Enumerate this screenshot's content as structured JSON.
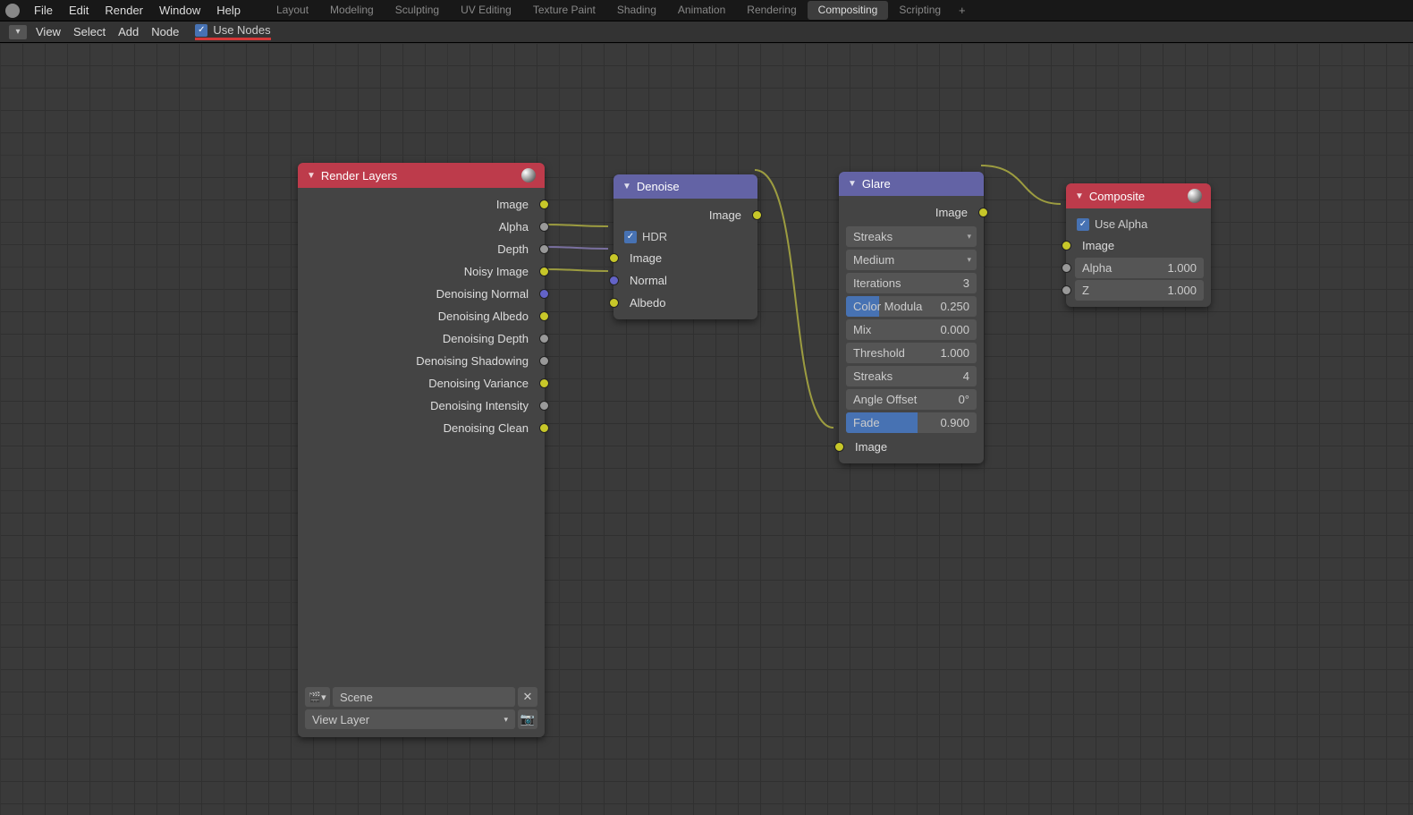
{
  "menu": {
    "file": "File",
    "edit": "Edit",
    "render": "Render",
    "window": "Window",
    "help": "Help"
  },
  "tabs": [
    "Layout",
    "Modeling",
    "Sculpting",
    "UV Editing",
    "Texture Paint",
    "Shading",
    "Animation",
    "Rendering",
    "Compositing",
    "Scripting"
  ],
  "active_tab": "Compositing",
  "submenu": {
    "view": "View",
    "select": "Select",
    "add": "Add",
    "node": "Node"
  },
  "use_nodes": "Use Nodes",
  "nodes": {
    "render": {
      "title": "Render Layers",
      "outputs": [
        "Image",
        "Alpha",
        "Depth",
        "Noisy Image",
        "Denoising Normal",
        "Denoising Albedo",
        "Denoising Depth",
        "Denoising Shadowing",
        "Denoising Variance",
        "Denoising Intensity",
        "Denoising Clean"
      ],
      "scene": "Scene",
      "view_layer": "View Layer"
    },
    "denoise": {
      "title": "Denoise",
      "out": "Image",
      "hdr": "HDR",
      "inputs": [
        "Image",
        "Normal",
        "Albedo"
      ]
    },
    "glare": {
      "title": "Glare",
      "out": "Image",
      "in": "Image",
      "type": "Streaks",
      "quality": "Medium",
      "props": {
        "iterations": {
          "l": "Iterations",
          "v": "3"
        },
        "colormod": {
          "l": "Color Modula",
          "v": "0.250",
          "fill": 25
        },
        "mix": {
          "l": "Mix",
          "v": "0.000"
        },
        "threshold": {
          "l": "Threshold",
          "v": "1.000"
        },
        "streaks": {
          "l": "Streaks",
          "v": "4"
        },
        "angle": {
          "l": "Angle Offset",
          "v": "0°"
        },
        "fade": {
          "l": "Fade",
          "v": "0.900",
          "fill": 60
        }
      }
    },
    "composite": {
      "title": "Composite",
      "use_alpha": "Use Alpha",
      "in_image": "Image",
      "alpha": {
        "l": "Alpha",
        "v": "1.000"
      },
      "z": {
        "l": "Z",
        "v": "1.000"
      }
    }
  }
}
